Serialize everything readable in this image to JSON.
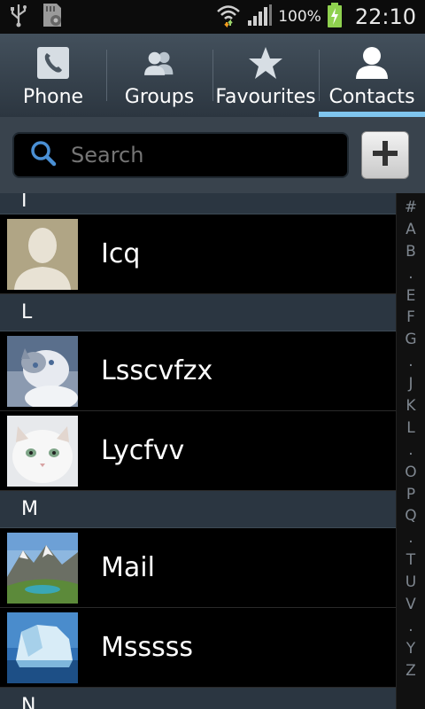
{
  "status_bar": {
    "battery_text": "100%",
    "time": "22:10",
    "icons": [
      "usb-icon",
      "sd-card-icon",
      "wifi-icon",
      "signal-icon",
      "battery-charging-icon"
    ]
  },
  "tabs": [
    {
      "label": "Phone",
      "icon": "phone-icon",
      "active": false
    },
    {
      "label": "Groups",
      "icon": "groups-icon",
      "active": false
    },
    {
      "label": "Favourites",
      "icon": "star-icon",
      "active": false
    },
    {
      "label": "Contacts",
      "icon": "contact-icon",
      "active": true
    }
  ],
  "search": {
    "placeholder": "Search",
    "add_icon": "plus-icon"
  },
  "list": {
    "headers": [
      "I",
      "L",
      "M",
      "N"
    ],
    "contacts": [
      {
        "name": "Icq",
        "avatar": "default-avatar"
      },
      {
        "name": "Lsscvfzx",
        "avatar": "cat-photo"
      },
      {
        "name": "Lycfvv",
        "avatar": "white-cat-photo"
      },
      {
        "name": "Mail",
        "avatar": "mountain-photo"
      },
      {
        "name": "Msssss",
        "avatar": "iceberg-photo"
      }
    ]
  },
  "index": [
    "#",
    "A",
    "B",
    ".",
    "E",
    "F",
    "G",
    ".",
    "J",
    "K",
    "L",
    ".",
    "O",
    "P",
    "Q",
    ".",
    "T",
    "U",
    "V",
    ".",
    "Y",
    "Z"
  ],
  "colors": {
    "accent": "#7fc5ee",
    "header_bg": "#2b3641",
    "tab_bg": "#38434e"
  }
}
